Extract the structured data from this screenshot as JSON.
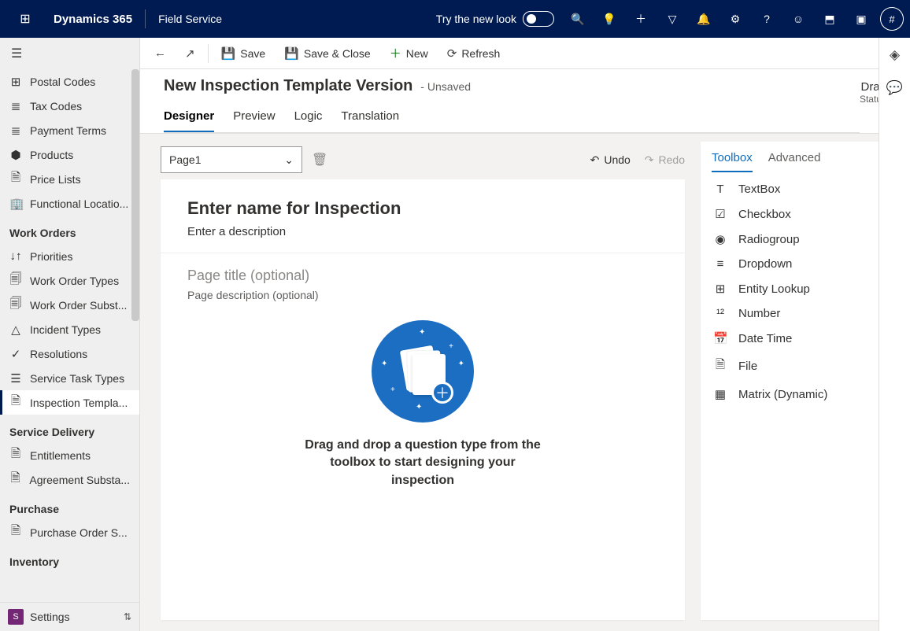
{
  "topnav": {
    "brand": "Dynamics 365",
    "app": "Field Service",
    "try_label": "Try the new look",
    "avatar_initial": "#"
  },
  "sidebar": {
    "items_top": [
      {
        "label": "Postal Codes",
        "icon": "⊞"
      },
      {
        "label": "Tax Codes",
        "icon": "≣"
      },
      {
        "label": "Payment Terms",
        "icon": "≣"
      },
      {
        "label": "Products",
        "icon": "⬢"
      },
      {
        "label": "Price Lists",
        "icon": "🗎"
      },
      {
        "label": "Functional Locatio...",
        "icon": "🏢"
      }
    ],
    "group_wo": "Work Orders",
    "items_wo": [
      {
        "label": "Priorities",
        "icon": "↓↑"
      },
      {
        "label": "Work Order Types",
        "icon": "🗐"
      },
      {
        "label": "Work Order Subst...",
        "icon": "🗐"
      },
      {
        "label": "Incident Types",
        "icon": "△"
      },
      {
        "label": "Resolutions",
        "icon": "✓"
      },
      {
        "label": "Service Task Types",
        "icon": "☰"
      },
      {
        "label": "Inspection Templa...",
        "icon": "🗎",
        "active": true
      }
    ],
    "group_sd": "Service Delivery",
    "items_sd": [
      {
        "label": "Entitlements",
        "icon": "🗎"
      },
      {
        "label": "Agreement Substa...",
        "icon": "🗎"
      }
    ],
    "group_pu": "Purchase",
    "items_pu": [
      {
        "label": "Purchase Order S...",
        "icon": "🗎"
      }
    ],
    "group_inv": "Inventory",
    "footer_badge": "S",
    "footer_label": "Settings"
  },
  "cmdbar": {
    "back": "",
    "open": "",
    "save": "Save",
    "save_close": "Save & Close",
    "new": "New",
    "refresh": "Refresh"
  },
  "header": {
    "title": "New Inspection Template Version",
    "unsaved": "- Unsaved",
    "status_value": "Draft",
    "status_label": "Status"
  },
  "tabs": [
    "Designer",
    "Preview",
    "Logic",
    "Translation"
  ],
  "active_tab": "Designer",
  "designer": {
    "page_selector": "Page1",
    "undo": "Undo",
    "redo": "Redo",
    "name_heading": "Enter name for Inspection",
    "desc_placeholder": "Enter a description",
    "page_title_placeholder": "Page title (optional)",
    "page_desc_placeholder": "Page description (optional)",
    "empty_text": "Drag and drop a question type from the toolbox to start designing your inspection"
  },
  "toolbox": {
    "tab_toolbox": "Toolbox",
    "tab_advanced": "Advanced",
    "items": [
      {
        "label": "TextBox",
        "icon": "T"
      },
      {
        "label": "Checkbox",
        "icon": "☑"
      },
      {
        "label": "Radiogroup",
        "icon": "◉"
      },
      {
        "label": "Dropdown",
        "icon": "≡"
      },
      {
        "label": "Entity Lookup",
        "icon": "⊞"
      },
      {
        "label": "Number",
        "icon": "¹²"
      },
      {
        "label": "Date Time",
        "icon": "📅"
      },
      {
        "label": "File",
        "icon": "🗎"
      },
      {
        "label": "Matrix (Dynamic)",
        "icon": "▦"
      }
    ]
  }
}
